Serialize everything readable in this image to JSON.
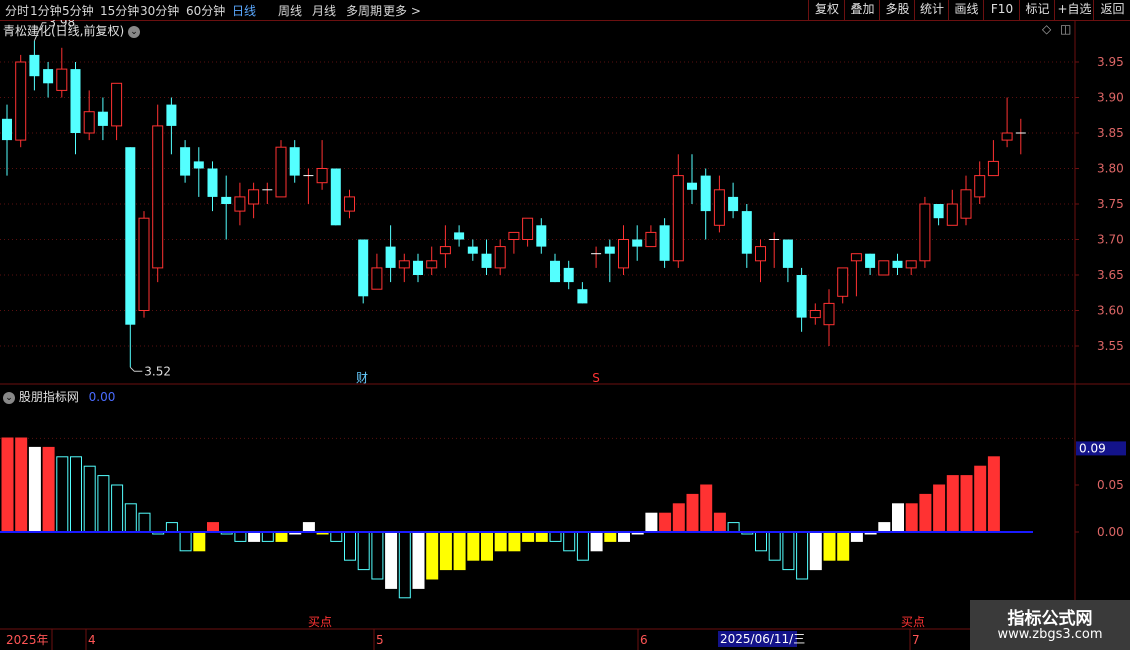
{
  "period_tabs": [
    {
      "label": "分时",
      "active": false
    },
    {
      "label": "1分钟",
      "active": false
    },
    {
      "label": "5分钟",
      "active": false
    },
    {
      "label": "15分钟",
      "active": false
    },
    {
      "label": "30分钟",
      "active": false
    },
    {
      "label": "60分钟",
      "active": false
    },
    {
      "label": "日线",
      "active": true
    },
    {
      "label": "周线",
      "active": false
    },
    {
      "label": "月线",
      "active": false
    },
    {
      "label": "多周期",
      "active": false
    },
    {
      "label": "更多 >",
      "active": false
    }
  ],
  "toolbar": [
    "复权",
    "叠加",
    "多股",
    "统计",
    "画线",
    "F10",
    "标记",
    "+自选",
    "返回"
  ],
  "main_title": "青松建化(日线,前复权)",
  "indicator_title": "股朋指标网",
  "indicator_value": "0.00",
  "high_label": "3.98",
  "low_label": "3.52",
  "markers": {
    "cai": "财",
    "s": "S"
  },
  "buy_points": [
    "买点",
    "买点"
  ],
  "date_axis": {
    "year": "2025年",
    "months": [
      "4",
      "5",
      "6",
      "7"
    ],
    "cursor": "2025/06/11/三"
  },
  "watermark": {
    "line1": "指标公式网",
    "line2": "www.zbgs3.com"
  },
  "colors": {
    "up": "#ff3232",
    "down": "#54ffff",
    "axis": "#6b1010",
    "zero": "#1a1aff",
    "yellow": "#ffff00",
    "white": "#ffffff"
  },
  "chart_data": [
    {
      "type": "candlestick",
      "ylim": [
        3.52,
        3.98
      ],
      "yticks": [
        3.55,
        3.6,
        3.65,
        3.7,
        3.75,
        3.8,
        3.85,
        3.9,
        3.95
      ],
      "ohlc": [
        [
          3.87,
          3.89,
          3.79,
          3.84
        ],
        [
          3.84,
          3.96,
          3.83,
          3.95
        ],
        [
          3.96,
          3.98,
          3.91,
          3.93
        ],
        [
          3.94,
          3.95,
          3.9,
          3.92
        ],
        [
          3.91,
          3.97,
          3.9,
          3.94
        ],
        [
          3.94,
          3.95,
          3.82,
          3.85
        ],
        [
          3.85,
          3.91,
          3.84,
          3.88
        ],
        [
          3.88,
          3.9,
          3.84,
          3.86
        ],
        [
          3.86,
          3.92,
          3.84,
          3.92
        ],
        [
          3.83,
          3.83,
          3.52,
          3.58
        ],
        [
          3.6,
          3.74,
          3.59,
          3.73
        ],
        [
          3.66,
          3.89,
          3.64,
          3.86
        ],
        [
          3.89,
          3.9,
          3.82,
          3.86
        ],
        [
          3.83,
          3.84,
          3.78,
          3.79
        ],
        [
          3.81,
          3.83,
          3.76,
          3.8
        ],
        [
          3.8,
          3.81,
          3.74,
          3.76
        ],
        [
          3.76,
          3.79,
          3.7,
          3.75
        ],
        [
          3.74,
          3.78,
          3.72,
          3.76
        ],
        [
          3.75,
          3.78,
          3.73,
          3.77
        ],
        [
          3.77,
          3.78,
          3.75,
          3.77
        ],
        [
          3.76,
          3.84,
          3.76,
          3.83
        ],
        [
          3.83,
          3.84,
          3.78,
          3.79
        ],
        [
          3.79,
          3.8,
          3.75,
          3.79
        ],
        [
          3.78,
          3.84,
          3.77,
          3.8
        ],
        [
          3.8,
          3.8,
          3.72,
          3.72
        ],
        [
          3.74,
          3.77,
          3.73,
          3.76
        ],
        [
          3.7,
          3.7,
          3.61,
          3.62
        ],
        [
          3.63,
          3.68,
          3.63,
          3.66
        ],
        [
          3.69,
          3.72,
          3.64,
          3.66
        ],
        [
          3.66,
          3.68,
          3.64,
          3.67
        ],
        [
          3.67,
          3.68,
          3.64,
          3.65
        ],
        [
          3.66,
          3.69,
          3.65,
          3.67
        ],
        [
          3.68,
          3.72,
          3.66,
          3.69
        ],
        [
          3.71,
          3.72,
          3.69,
          3.7
        ],
        [
          3.69,
          3.7,
          3.67,
          3.68
        ],
        [
          3.68,
          3.7,
          3.65,
          3.66
        ],
        [
          3.66,
          3.7,
          3.65,
          3.69
        ],
        [
          3.7,
          3.71,
          3.68,
          3.71
        ],
        [
          3.7,
          3.73,
          3.69,
          3.73
        ],
        [
          3.72,
          3.73,
          3.68,
          3.69
        ],
        [
          3.67,
          3.68,
          3.64,
          3.64
        ],
        [
          3.66,
          3.67,
          3.63,
          3.64
        ],
        [
          3.63,
          3.64,
          3.61,
          3.61
        ],
        [
          3.68,
          3.69,
          3.66,
          3.68
        ],
        [
          3.69,
          3.7,
          3.64,
          3.68
        ],
        [
          3.66,
          3.72,
          3.65,
          3.7
        ],
        [
          3.7,
          3.72,
          3.67,
          3.69
        ],
        [
          3.69,
          3.72,
          3.69,
          3.71
        ],
        [
          3.72,
          3.73,
          3.66,
          3.67
        ],
        [
          3.67,
          3.82,
          3.66,
          3.79
        ],
        [
          3.78,
          3.82,
          3.75,
          3.77
        ],
        [
          3.79,
          3.8,
          3.7,
          3.74
        ],
        [
          3.72,
          3.79,
          3.71,
          3.77
        ],
        [
          3.76,
          3.78,
          3.73,
          3.74
        ],
        [
          3.74,
          3.75,
          3.66,
          3.68
        ],
        [
          3.67,
          3.7,
          3.64,
          3.69
        ],
        [
          3.7,
          3.71,
          3.66,
          3.7
        ],
        [
          3.7,
          3.7,
          3.64,
          3.66
        ],
        [
          3.65,
          3.66,
          3.57,
          3.59
        ],
        [
          3.59,
          3.61,
          3.58,
          3.6
        ],
        [
          3.58,
          3.63,
          3.55,
          3.61
        ],
        [
          3.62,
          3.66,
          3.61,
          3.66
        ],
        [
          3.67,
          3.68,
          3.62,
          3.68
        ],
        [
          3.68,
          3.68,
          3.65,
          3.66
        ],
        [
          3.65,
          3.67,
          3.65,
          3.67
        ],
        [
          3.67,
          3.68,
          3.65,
          3.66
        ],
        [
          3.66,
          3.67,
          3.65,
          3.67
        ],
        [
          3.67,
          3.76,
          3.66,
          3.75
        ],
        [
          3.75,
          3.75,
          3.72,
          3.73
        ],
        [
          3.72,
          3.77,
          3.72,
          3.75
        ],
        [
          3.73,
          3.79,
          3.72,
          3.77
        ],
        [
          3.76,
          3.81,
          3.75,
          3.79
        ],
        [
          3.79,
          3.84,
          3.79,
          3.81
        ],
        [
          3.84,
          3.9,
          3.83,
          3.85
        ],
        [
          3.85,
          3.87,
          3.82,
          3.85
        ]
      ]
    },
    {
      "type": "bar",
      "title": "股朋指标网",
      "yticks": [
        0.0,
        0.05
      ],
      "current": 0.09,
      "bars": [
        [
          0.1,
          "red"
        ],
        [
          0.1,
          "red"
        ],
        [
          0.09,
          "white"
        ],
        [
          0.09,
          "red"
        ],
        [
          0.08,
          "cyan"
        ],
        [
          0.08,
          "cyan"
        ],
        [
          0.07,
          "cyan"
        ],
        [
          0.06,
          "cyan"
        ],
        [
          0.05,
          "cyan"
        ],
        [
          0.03,
          "cyan"
        ],
        [
          0.02,
          "cyan"
        ],
        [
          0.0,
          "cyan"
        ],
        [
          0.01,
          "cyan"
        ],
        [
          -0.02,
          "cyan"
        ],
        [
          -0.02,
          "yellow"
        ],
        [
          0.01,
          "red"
        ],
        [
          0.0,
          "cyan"
        ],
        [
          -0.01,
          "cyan"
        ],
        [
          -0.01,
          "white"
        ],
        [
          -0.01,
          "cyan"
        ],
        [
          -0.01,
          "yellow"
        ],
        [
          0.0,
          "white"
        ],
        [
          0.01,
          "white"
        ],
        [
          0.0,
          "yellow"
        ],
        [
          -0.01,
          "cyan"
        ],
        [
          -0.03,
          "cyan"
        ],
        [
          -0.04,
          "cyan"
        ],
        [
          -0.05,
          "cyan"
        ],
        [
          -0.06,
          "white"
        ],
        [
          -0.07,
          "cyan"
        ],
        [
          -0.06,
          "white"
        ],
        [
          -0.05,
          "yellow"
        ],
        [
          -0.04,
          "yellow"
        ],
        [
          -0.04,
          "yellow"
        ],
        [
          -0.03,
          "yellow"
        ],
        [
          -0.03,
          "yellow"
        ],
        [
          -0.02,
          "yellow"
        ],
        [
          -0.02,
          "yellow"
        ],
        [
          -0.01,
          "yellow"
        ],
        [
          -0.01,
          "yellow"
        ],
        [
          -0.01,
          "cyan"
        ],
        [
          -0.02,
          "cyan"
        ],
        [
          -0.03,
          "cyan"
        ],
        [
          -0.02,
          "white"
        ],
        [
          -0.01,
          "yellow"
        ],
        [
          -0.01,
          "white"
        ],
        [
          0.0,
          "white"
        ],
        [
          0.02,
          "white"
        ],
        [
          0.02,
          "red"
        ],
        [
          0.03,
          "red"
        ],
        [
          0.04,
          "red"
        ],
        [
          0.05,
          "red"
        ],
        [
          0.02,
          "red"
        ],
        [
          0.01,
          "cyan"
        ],
        [
          0.0,
          "cyan"
        ],
        [
          -0.02,
          "cyan"
        ],
        [
          -0.03,
          "cyan"
        ],
        [
          -0.04,
          "cyan"
        ],
        [
          -0.05,
          "cyan"
        ],
        [
          -0.04,
          "white"
        ],
        [
          -0.03,
          "yellow"
        ],
        [
          -0.03,
          "yellow"
        ],
        [
          -0.01,
          "white"
        ],
        [
          0.0,
          "white"
        ],
        [
          0.01,
          "white"
        ],
        [
          0.03,
          "white"
        ],
        [
          0.03,
          "red"
        ],
        [
          0.04,
          "red"
        ],
        [
          0.05,
          "red"
        ],
        [
          0.06,
          "red"
        ],
        [
          0.06,
          "red"
        ],
        [
          0.07,
          "red"
        ],
        [
          0.08,
          "red"
        ]
      ]
    }
  ]
}
